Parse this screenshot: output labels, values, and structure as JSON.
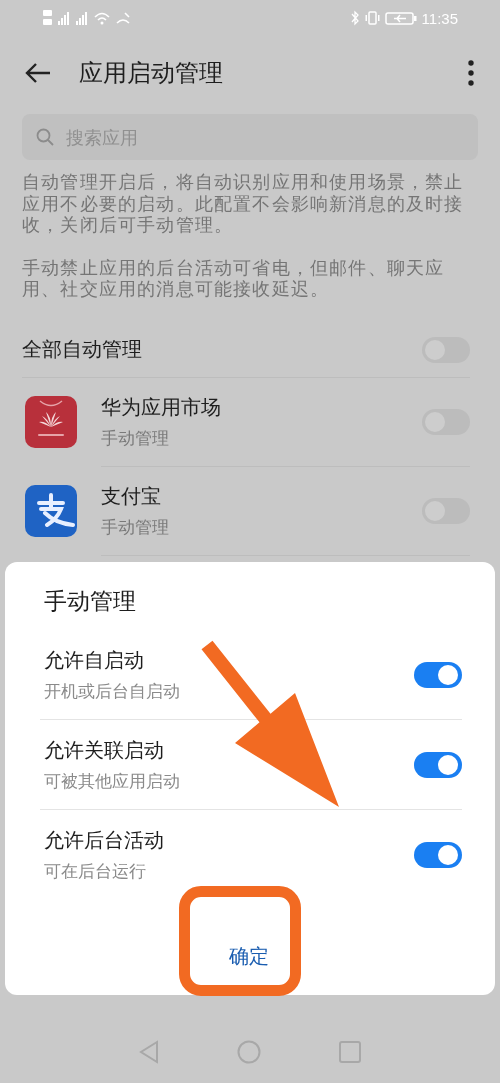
{
  "status_bar": {
    "time": "11:35"
  },
  "app_bar": {
    "title": "应用启动管理"
  },
  "search": {
    "placeholder": "搜索应用"
  },
  "notes": [
    "自动管理开启后，将自动识别应用和使用场景，禁止应用不必要的启动。此配置不会影响新消息的及时接收，关闭后可手动管理。",
    "手动禁止应用的后台活动可省电，但邮件、聊天应用、社交应用的消息可能接收延迟。"
  ],
  "auto_all": {
    "label": "全部自动管理",
    "on": false
  },
  "apps": [
    {
      "kind": "market",
      "name": "华为应用市场",
      "mode": "手动管理",
      "on": false
    },
    {
      "kind": "pay",
      "name": "支付宝",
      "mode": "手动管理",
      "on": false
    }
  ],
  "dialog": {
    "title": "手动管理",
    "options": [
      {
        "label": "允许自启动",
        "hint": "开机或后台自启动",
        "on": true
      },
      {
        "label": "允许关联启动",
        "hint": "可被其他应用启动",
        "on": true
      },
      {
        "label": "允许后台活动",
        "hint": "可在后台运行",
        "on": true
      }
    ],
    "confirm": "确定"
  }
}
